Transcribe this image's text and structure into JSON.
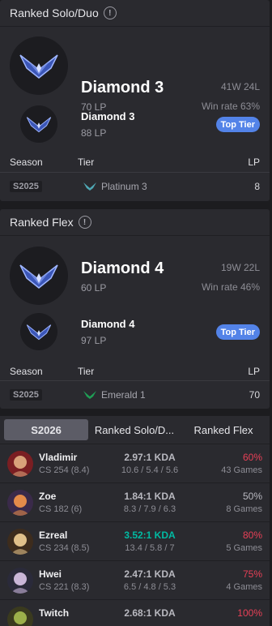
{
  "colors": {
    "top_tier": "#5383e8",
    "kda_good": "#00bba3",
    "winrate_high": "#e84057",
    "platinum": "#4fa8b5",
    "emerald": "#1f9e55"
  },
  "solo": {
    "title": "Ranked Solo/Duo",
    "current": {
      "tier": "Diamond 3",
      "lp": "70 LP",
      "record": "41W 24L",
      "winrate": "Win rate 63%"
    },
    "peak": {
      "tier": "Diamond 3",
      "lp": "88 LP",
      "badge": "Top Tier"
    },
    "history_headers": {
      "season": "Season",
      "tier": "Tier",
      "lp": "LP"
    },
    "history": [
      {
        "season": "S2025",
        "tier": "Platinum 3",
        "tier_icon": "platinum-crest-icon",
        "lp": "8"
      }
    ]
  },
  "flex": {
    "title": "Ranked Flex",
    "current": {
      "tier": "Diamond 4",
      "lp": "60 LP",
      "record": "19W 22L",
      "winrate": "Win rate 46%"
    },
    "peak": {
      "tier": "Diamond 4",
      "lp": "97 LP",
      "badge": "Top Tier"
    },
    "history_headers": {
      "season": "Season",
      "tier": "Tier",
      "lp": "LP"
    },
    "history": [
      {
        "season": "S2025",
        "tier": "Emerald 1",
        "tier_icon": "emerald-crest-icon",
        "lp": "70"
      }
    ]
  },
  "champ_tabs": [
    "S2026",
    "Ranked Solo/D...",
    "Ranked Flex"
  ],
  "champions": [
    {
      "name": "Vladimir",
      "cs": "CS 254 (8.4)",
      "kda": "2.97:1 KDA",
      "kda_detail": "10.6 / 5.4 / 5.6",
      "winrate": "60%",
      "games": "43 Games"
    },
    {
      "name": "Zoe",
      "cs": "CS 182 (6)",
      "kda": "1.84:1 KDA",
      "kda_detail": "8.3 / 7.9 / 6.3",
      "winrate": "50%",
      "games": "8 Games"
    },
    {
      "name": "Ezreal",
      "cs": "CS 234 (8.5)",
      "kda": "3.52:1 KDA",
      "kda_detail": "13.4 / 5.8 / 7",
      "winrate": "80%",
      "games": "5 Games"
    },
    {
      "name": "Hwei",
      "cs": "CS 221 (8.3)",
      "kda": "2.47:1 KDA",
      "kda_detail": "6.5 / 4.8 / 5.3",
      "winrate": "75%",
      "games": "4 Games"
    },
    {
      "name": "Twitch",
      "cs": "",
      "kda": "2.68:1 KDA",
      "kda_detail": "",
      "winrate": "100%",
      "games": ""
    }
  ]
}
